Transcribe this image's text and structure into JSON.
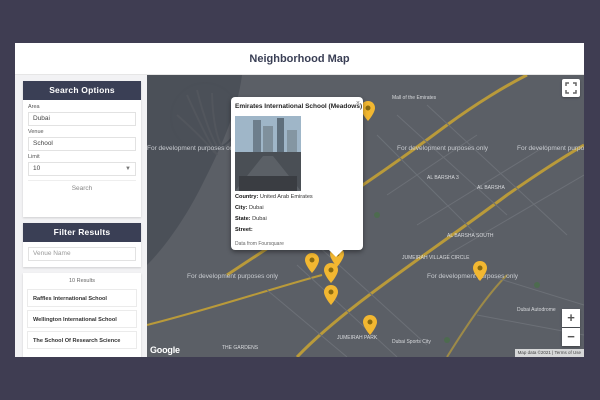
{
  "header": {
    "title": "Neighborhood Map"
  },
  "search": {
    "title": "Search Options",
    "area_label": "Area",
    "area_value": "Dubai",
    "venue_label": "Venue",
    "venue_value": "School",
    "limit_label": "Limit",
    "limit_value": "10",
    "button_label": "Search"
  },
  "filter": {
    "title": "Filter Results",
    "placeholder": "Venue Name"
  },
  "results": {
    "count_text": "10 Results",
    "items": [
      {
        "label": "Raffles International School"
      },
      {
        "label": "Wellington International School"
      },
      {
        "label": "The School Of Research Science"
      }
    ]
  },
  "map": {
    "watermark": "For development purposes only",
    "labels": {
      "al_barsha_3": "AL BARSHA 3",
      "al_barsha": "AL BARSHA",
      "al_barsha_south": "AL BARSHA SOUTH",
      "jumeirah_village_circle": "JUMEIRAH VILLAGE CIRCLE",
      "jumeirah_park": "JUMEIRAH PARK",
      "the_gardens": "THE GARDENS",
      "dubai_autodrome": "Dubai Autodrome",
      "dubai_sports_city": "Dubai Sports City",
      "mall_of_emirates": "Mall of the Emirates"
    },
    "google_logo": "Google",
    "attribution": "Map data ©2021 | Terms of Use",
    "zoom_in": "+",
    "zoom_out": "−"
  },
  "info_window": {
    "title": "Emirates International School (Meadows)",
    "country_label": "Country:",
    "country_value": "United Arab Emirates",
    "city_label": "City:",
    "city_value": "Dubai",
    "state_label": "State:",
    "state_value": "Dubai",
    "street_label": "Street:",
    "street_value": "",
    "source_text": "Data from Foursquare",
    "close_symbol": "×"
  },
  "colors": {
    "header_dark": "#3a3f55",
    "pin": "#f2b731",
    "map_bg": "#5b5f66",
    "page_bg": "#3f3d52"
  }
}
